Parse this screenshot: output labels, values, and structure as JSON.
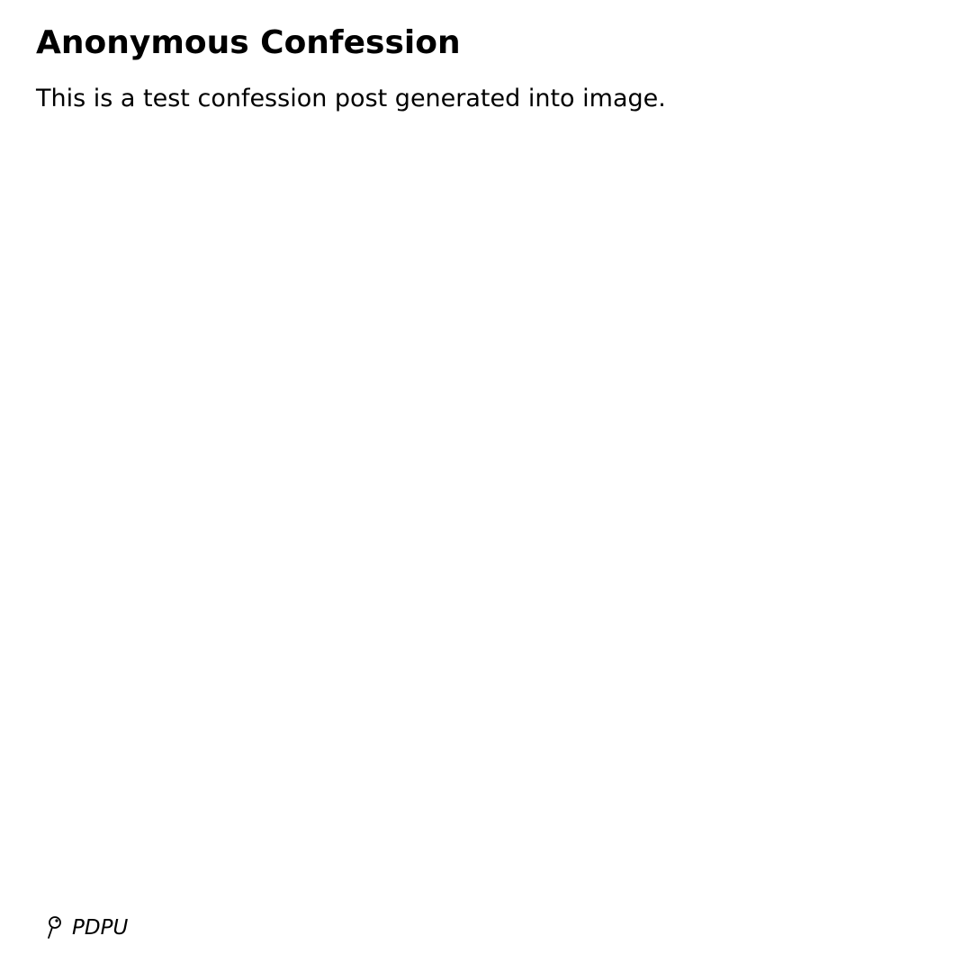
{
  "post": {
    "title": "Anonymous Confession",
    "body": "This is a test confession post generated into image."
  },
  "footer": {
    "icon": "location-pin-icon",
    "location": "PDPU"
  }
}
